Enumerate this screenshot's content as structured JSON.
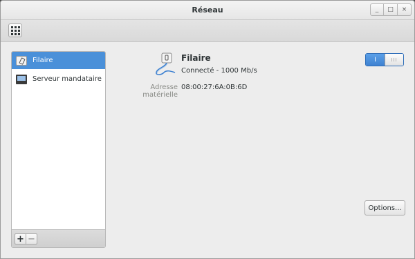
{
  "window": {
    "title": "Réseau",
    "controls": [
      "_",
      "□",
      "×"
    ]
  },
  "toolbar": {
    "grid_icon": "app-grid-icon"
  },
  "sidebar": {
    "items": [
      {
        "label": "Filaire",
        "icon": "wired-network-icon",
        "selected": true
      },
      {
        "label": "Serveur mandataire",
        "icon": "proxy-server-icon",
        "selected": false
      }
    ],
    "add_label": "+",
    "remove_label": "−"
  },
  "detail": {
    "icon": "wired-network-icon",
    "title": "Filaire",
    "status": "Connecté - 1000 Mb/s",
    "hw_label": "Adresse matérielle",
    "hw_value": "08:00:27:6A:0B:6D",
    "switch": {
      "on": true,
      "on_text": "I",
      "knob_text": "III"
    },
    "options_label": "Options..."
  },
  "colors": {
    "selection": "#4a90d9",
    "switch_on": "#3f82d1"
  }
}
